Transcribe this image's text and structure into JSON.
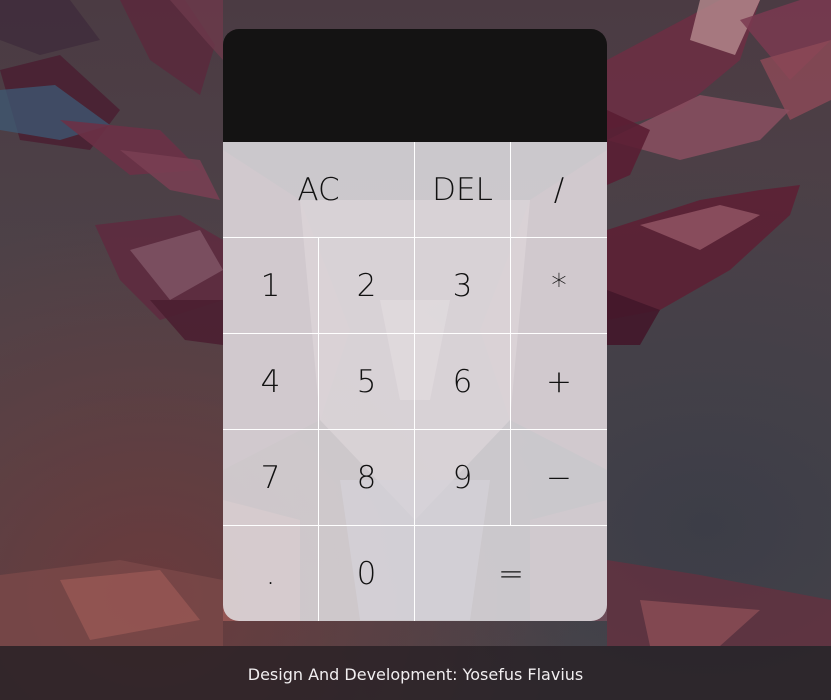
{
  "display": {
    "value": ""
  },
  "keys": {
    "ac": "AC",
    "del": "DEL",
    "divide": "/",
    "one": "1",
    "two": "2",
    "three": "3",
    "multiply": "*",
    "four": "4",
    "five": "5",
    "six": "6",
    "plus": "+",
    "seven": "7",
    "eight": "8",
    "nine": "9",
    "minus": "−",
    "dot": ".",
    "zero": "0",
    "equals": "="
  },
  "footer": {
    "credit": "Design And Development: Yosefus Flavius"
  },
  "colors": {
    "display_bg": "#141313",
    "key_bg": "#e1dee2",
    "footer_text": "#f1eef0"
  }
}
